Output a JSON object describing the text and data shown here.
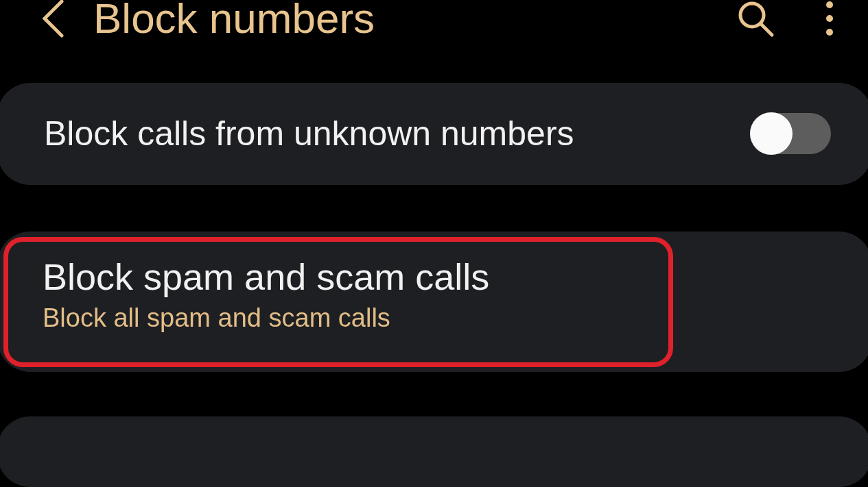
{
  "header": {
    "title": "Block numbers"
  },
  "settings": [
    {
      "kind": "toggle",
      "label": "Block calls from unknown numbers",
      "on": false
    },
    {
      "kind": "link",
      "label": "Block spam and scam calls",
      "summary": "Block all spam and scam calls",
      "highlighted": true
    },
    {
      "kind": "empty"
    }
  ]
}
